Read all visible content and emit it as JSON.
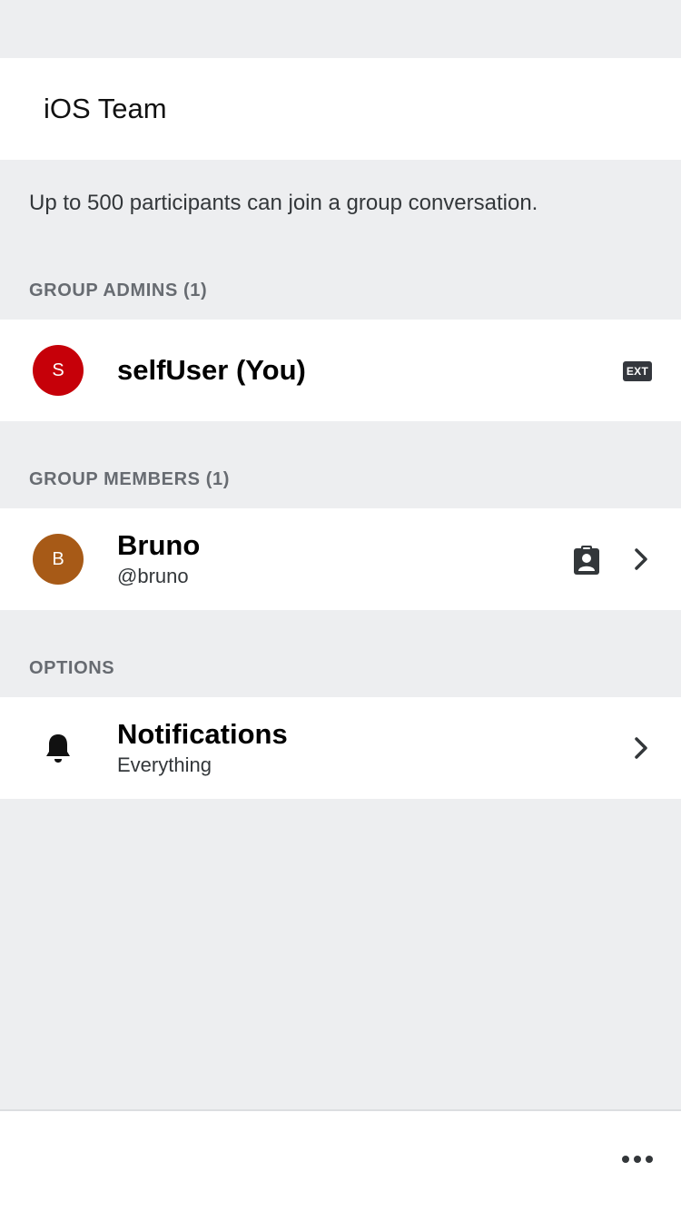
{
  "conversation": {
    "title": "iOS Team"
  },
  "info": {
    "participants_note": "Up to 500 participants can join a group conversation."
  },
  "admins": {
    "header": "GROUP ADMINS (1)",
    "items": [
      {
        "initial": "S",
        "name": "selfUser (You)",
        "badge": "EXT",
        "avatar_color": "#C60009"
      }
    ]
  },
  "members": {
    "header": "GROUP MEMBERS (1)",
    "items": [
      {
        "initial": "B",
        "name": "Bruno",
        "handle": "@bruno",
        "avatar_color": "#A75A17"
      }
    ]
  },
  "options": {
    "header": "OPTIONS",
    "notifications": {
      "title": "Notifications",
      "value": "Everything"
    }
  },
  "colors": {
    "background": "#EDEEF0",
    "cell": "#FFFFFF",
    "icon": "#33373A"
  },
  "icons": {
    "member_status": "contact-card-icon",
    "notifications": "bell-icon",
    "disclosure": "chevron-right-icon",
    "more": "ellipsis-icon"
  }
}
